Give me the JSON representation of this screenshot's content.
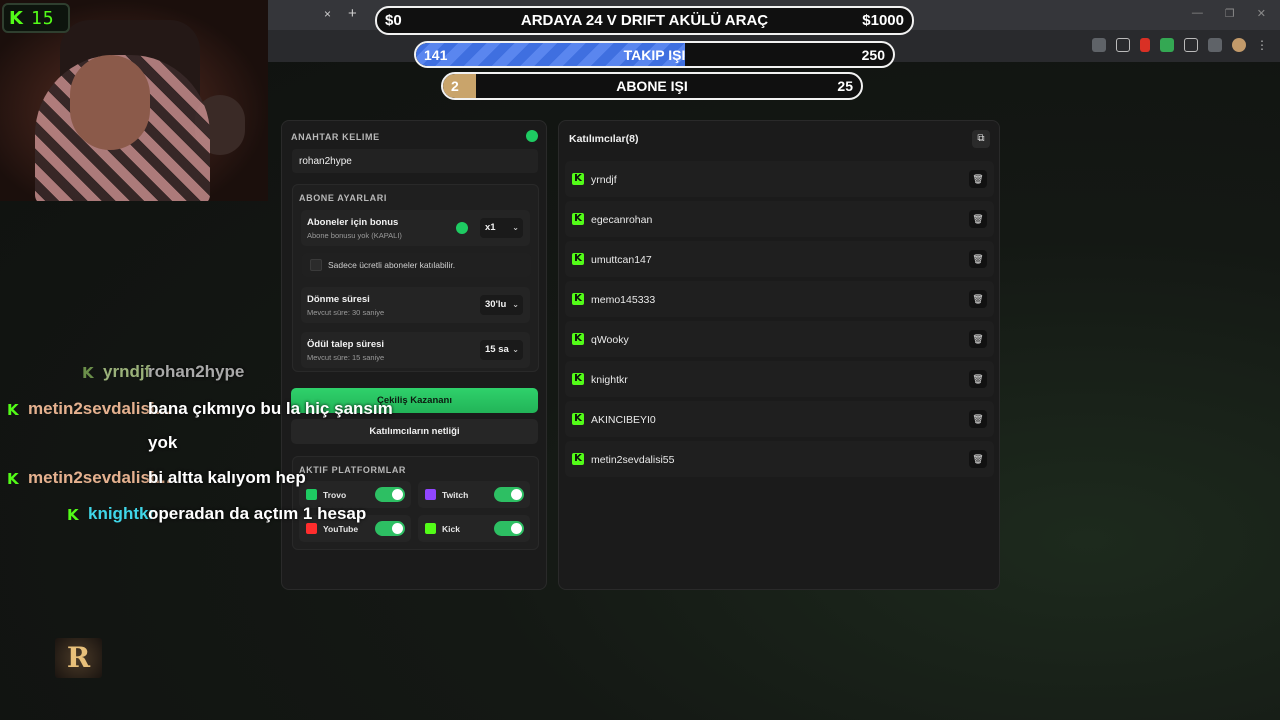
{
  "viewer_count": "15",
  "goals": [
    {
      "left": "$0",
      "title": "ARDAYA 24 V DRIFT AKÜLÜ ARAÇ",
      "right": "$1000",
      "progress": 0.0
    },
    {
      "left": "141",
      "title": "TAKIP IŞI",
      "right": "250",
      "progress": 0.564
    },
    {
      "left": "2",
      "title": "ABONE IŞI",
      "right": "25",
      "progress": 0.08
    }
  ],
  "browser": {
    "tab_close": "×",
    "tab_new": "+",
    "win_minimize": "—",
    "win_restore": "❐",
    "win_close": "✕"
  },
  "left_panel": {
    "keyword_label": "ANAHTAR KELIME",
    "keyword_value": "rohan2hype",
    "sub_settings_label": "ABONE AYARLARI",
    "bonus_title": "Aboneler için bonus",
    "bonus_desc": "Abone bonusu yok (KAPALI)",
    "bonus_select": "x1",
    "checkbox_label": "Sadece ücretli aboneler katılabilir.",
    "spin_title": "Dönme süresi",
    "spin_desc": "Mevcut süre: 30 saniye",
    "spin_select": "30'lu",
    "claim_title": "Ödül talep süresi",
    "claim_desc": "Mevcut süre: 15 saniye",
    "claim_select": "15 sa",
    "btn_draw": "Çekiliş Kazananı",
    "btn_participants": "Katılımcıların netliği",
    "platforms_label": "AKTIF PLATFORMLAR",
    "platforms": [
      {
        "name": "Trovo",
        "color": "#1ecb62",
        "enabled": true
      },
      {
        "name": "Twitch",
        "color": "#9146ff",
        "enabled": true
      },
      {
        "name": "YouTube",
        "color": "#ff2d2d",
        "enabled": true
      },
      {
        "name": "Kick",
        "color": "#53fc18",
        "enabled": true
      }
    ]
  },
  "right_panel": {
    "title": "Katılımcılar(8)",
    "participants": [
      "yrndjf",
      "egecanrohan",
      "umuttcan147",
      "memo145333",
      "qWooky",
      "knightkr",
      "AKINCIBEYI0",
      "metin2sevdalisi55"
    ]
  },
  "chat": [
    {
      "user": "yrndjf",
      "user_color": "#9bb27a",
      "message": "rohan2hype",
      "msg_color": "#a9a9a9"
    },
    {
      "user": "metin2sevdalisi…",
      "user_color": "#e5b18f",
      "message": "bana çıkmıyo bu la hiç şansım",
      "msg_color": "#ffffff"
    },
    {
      "user": "",
      "user_color": "#e5b18f",
      "message": "yok",
      "msg_color": "#ffffff"
    },
    {
      "user": "metin2sevdalisi…",
      "user_color": "#e5b18f",
      "message": "bi altta kalıyom hep",
      "msg_color": "#ffffff"
    },
    {
      "user": "knightkr",
      "user_color": "#3fd6e8",
      "message": "operadan da açtım 1 hesap",
      "msg_color": "#ffffff"
    }
  ],
  "logo_letter": "R",
  "accent_color": "#53fc18"
}
